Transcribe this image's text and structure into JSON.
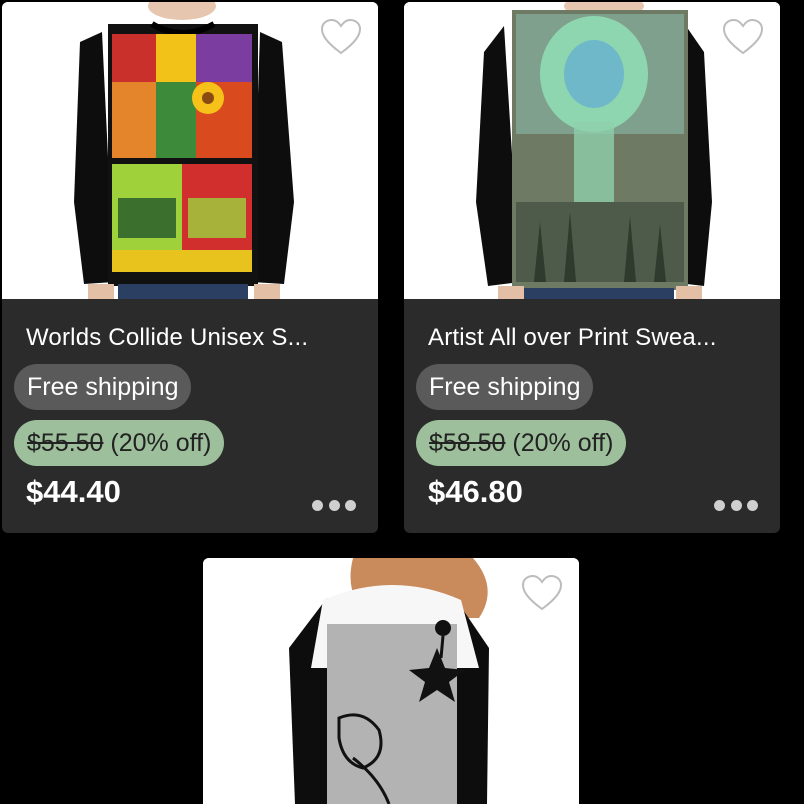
{
  "products": [
    {
      "title": "Worlds Collide Unisex S...",
      "shipping": "Free shipping",
      "original_price": "$55.50",
      "discount": "(20% off)",
      "price": "$44.40",
      "heart_icon": "heart-outline-icon",
      "more_icon": "more-dots-icon"
    },
    {
      "title": "Artist All over Print Swea...",
      "shipping": "Free shipping",
      "original_price": "$58.50",
      "discount": "(20% off)",
      "price": "$46.80",
      "heart_icon": "heart-outline-icon",
      "more_icon": "more-dots-icon"
    },
    {
      "heart_icon": "heart-outline-icon"
    }
  ],
  "colors": {
    "background": "#000000",
    "card": "#2b2b2b",
    "shipping_badge": "#5a5a5a",
    "discount_badge": "#9dbf9b"
  }
}
